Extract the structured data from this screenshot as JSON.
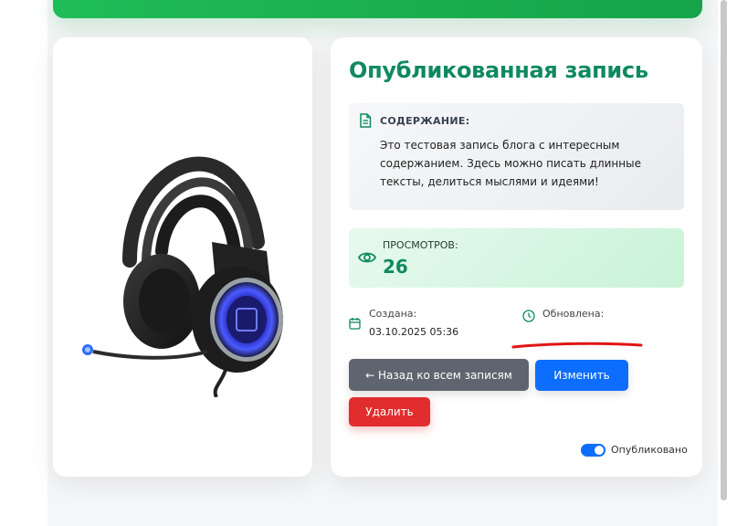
{
  "post": {
    "title": "Опубликованная запись",
    "content_heading": "СОДЕРЖАНИЕ:",
    "content_text": "Это тестовая запись блога с интересным содержанием. Здесь можно писать длинные тексты, делиться мыслями и идеями!",
    "views_label": "ПРОСМОТРОВ:",
    "views_count": "26",
    "created_label": "Создана:",
    "created_value": "03.10.2025 05:36",
    "updated_label": "Обновлена:"
  },
  "actions": {
    "back_label": "← Назад ко всем записям",
    "edit_label": "Изменить",
    "delete_label": "Удалить"
  },
  "published_toggle": {
    "label": "Опубликовано",
    "checked": true
  },
  "icons": {
    "content": "document-icon",
    "views": "eye-icon",
    "created": "calendar-icon",
    "updated": "clock-icon",
    "image": "headphones-image"
  },
  "colors": {
    "accent_green": "#0f8a5f",
    "banner_green": "#16a34a",
    "primary_blue": "#0d6efd",
    "danger_red": "#e12d2d",
    "secondary_gray": "#5f6570"
  }
}
